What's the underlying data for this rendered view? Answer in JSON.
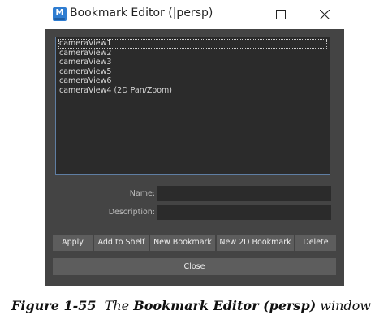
{
  "window": {
    "title": "Bookmark Editor (|persp)",
    "app_icon_letter": "M"
  },
  "bookmarks": [
    "cameraView1",
    "cameraView2",
    "cameraView3",
    "cameraView5",
    "cameraView6",
    "cameraView4 (2D Pan/Zoom)"
  ],
  "selected_index": 0,
  "form": {
    "name_label": "Name:",
    "name_value": "",
    "description_label": "Description:",
    "description_value": ""
  },
  "buttons": {
    "apply": "Apply",
    "add_to_shelf": "Add to Shelf",
    "new_bookmark": "New Bookmark",
    "new_2d_bookmark": "New 2D Bookmark",
    "delete": "Delete",
    "close": "Close"
  },
  "caption": {
    "figure": "Figure 1-55",
    "the": "The",
    "name": "Bookmark Editor (persp)",
    "rest": "window"
  },
  "colors": {
    "panel": "#444444",
    "field": "#2b2b2b",
    "button": "#5d5d5d",
    "list_border": "#5f7ea3"
  }
}
